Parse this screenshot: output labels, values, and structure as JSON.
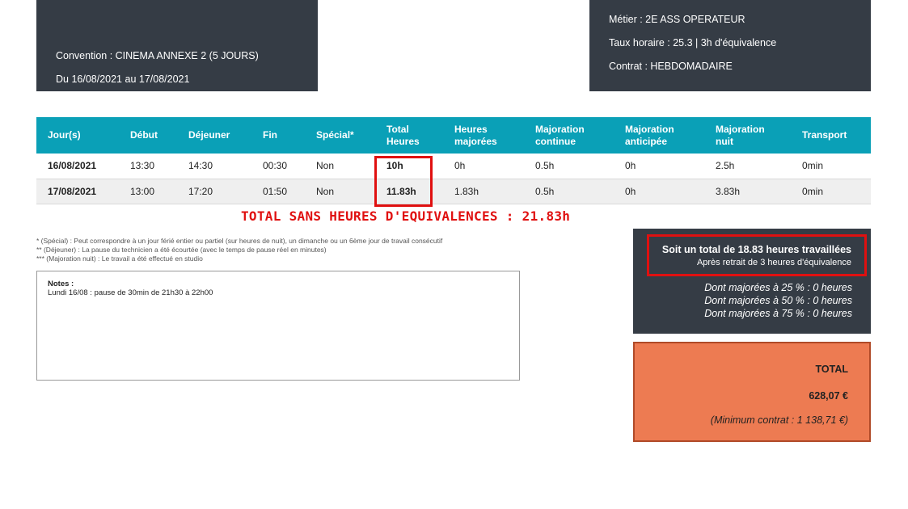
{
  "header_left": {
    "convention": "Convention : CINEMA ANNEXE 2 (5 JOURS)",
    "period": "Du 16/08/2021 au 17/08/2021"
  },
  "header_right": {
    "metier": "Métier : 2E ASS OPERATEUR",
    "taux": "Taux horaire : 25.3 | 3h d'équivalence",
    "contrat": "Contrat : HEBDOMADAIRE"
  },
  "table": {
    "headers": [
      {
        "l1": "Jour(s)",
        "l2": ""
      },
      {
        "l1": "Début",
        "l2": ""
      },
      {
        "l1": "Déjeuner",
        "l2": ""
      },
      {
        "l1": "Fin",
        "l2": ""
      },
      {
        "l1": "Spécial*",
        "l2": ""
      },
      {
        "l1": "Total",
        "l2": "Heures"
      },
      {
        "l1": "Heures",
        "l2": "majorées"
      },
      {
        "l1": "Majoration",
        "l2": "continue"
      },
      {
        "l1": "Majoration",
        "l2": "anticipée"
      },
      {
        "l1": "Majoration",
        "l2": "nuit"
      },
      {
        "l1": "Transport",
        "l2": ""
      }
    ],
    "rows": [
      [
        "16/08/2021",
        "13:30",
        "14:30",
        "00:30",
        "Non",
        "10h",
        "0h",
        "0.5h",
        "0h",
        "2.5h",
        "0min"
      ],
      [
        "17/08/2021",
        "13:00",
        "17:20",
        "01:50",
        "Non",
        "11.83h",
        "1.83h",
        "0.5h",
        "0h",
        "3.83h",
        "0min"
      ]
    ]
  },
  "total_heading": "TOTAL SANS HEURES D'EQUIVALENCES : 21.83h",
  "footnotes": [
    "* (Spécial) : Peut correspondre à un jour férié entier ou partiel (sur heures de nuit), un dimanche ou un 6ème jour de travail consécutif",
    "** (Déjeuner) : La pause du technicien a été écourtée (avec le temps de pause réel en minutes)",
    "*** (Majoration nuit) : Le travail a été effectué en studio"
  ],
  "notes": {
    "title": "Notes :",
    "text": "Lundi 16/08 : pause de 30min de 21h30 à 22h00"
  },
  "summary": {
    "main": "Soit un total de 18.83 heures travaillées",
    "sub": "Après retrait de 3 heures d'équivalence",
    "maj25": "Dont majorées à 25 % : 0 heures",
    "maj50": "Dont majorées à 50 % : 0 heures",
    "maj75": "Dont majorées à 75 % : 0 heures"
  },
  "total": {
    "label": "TOTAL",
    "amount": "628,07 €",
    "minimum": "(Minimum contrat : 1 138,71 €)"
  },
  "colors": {
    "dark": "#353c45",
    "teal": "#0aa0b7",
    "red": "#e01010",
    "orange": "#ed7b52"
  }
}
